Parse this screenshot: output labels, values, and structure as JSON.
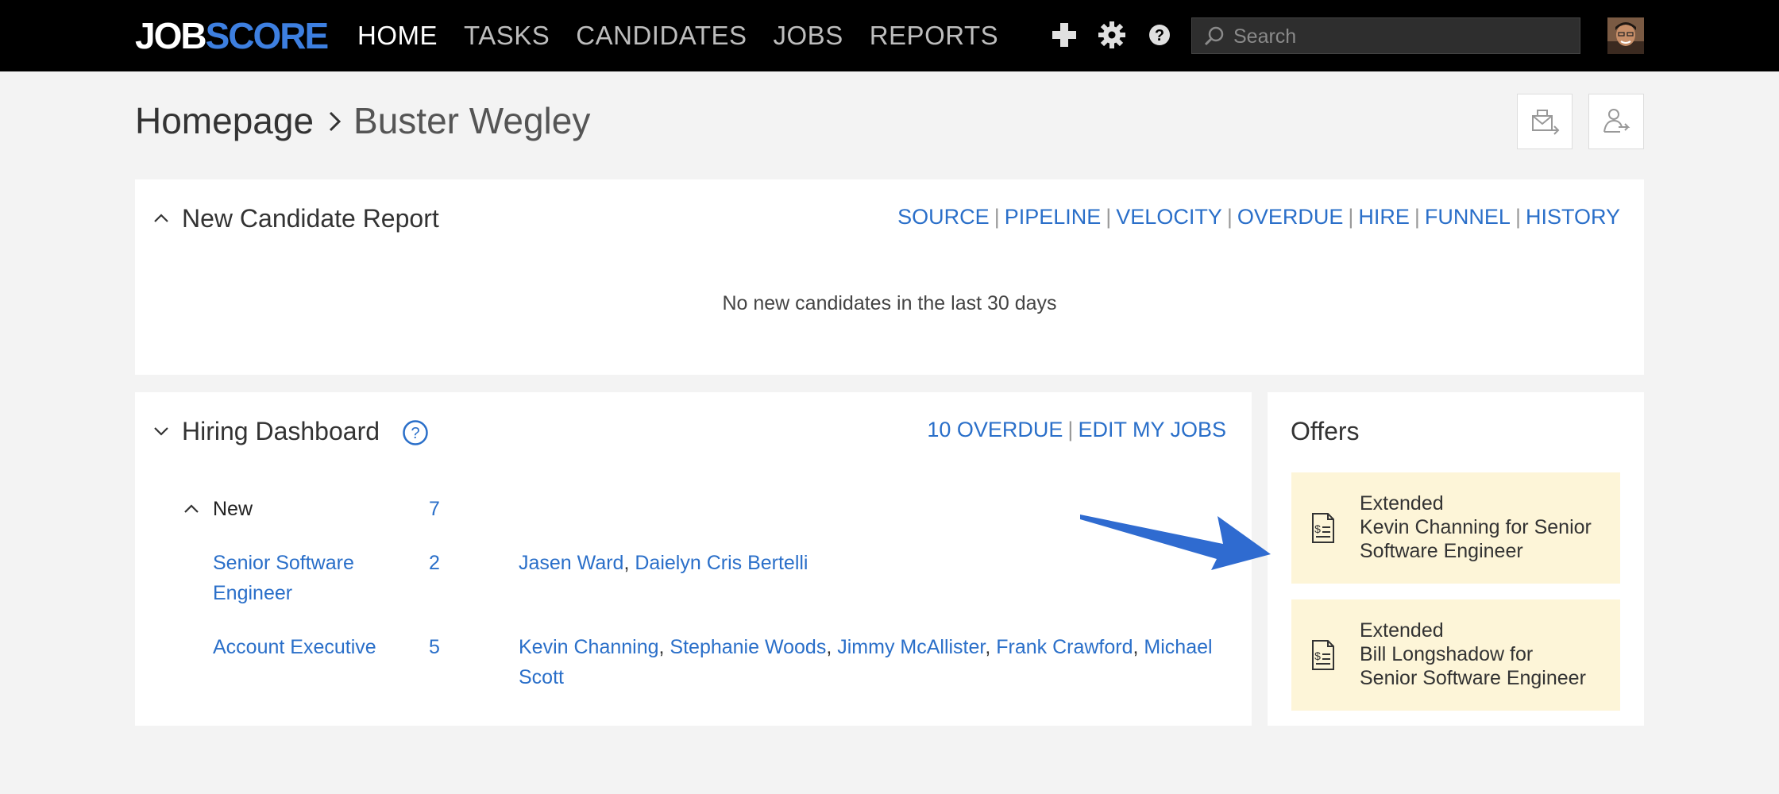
{
  "app": {
    "logo_part1": "JOB",
    "logo_part2": "SCORE",
    "accent": "#3d7fe0"
  },
  "nav": {
    "items": [
      {
        "label": "HOME",
        "active": true
      },
      {
        "label": "TASKS",
        "active": false
      },
      {
        "label": "CANDIDATES",
        "active": false
      },
      {
        "label": "JOBS",
        "active": false
      },
      {
        "label": "REPORTS",
        "active": false
      }
    ]
  },
  "toolbar": {
    "icons": [
      "plus-icon",
      "gear-icon",
      "help-icon"
    ],
    "search_placeholder": "Search"
  },
  "header": {
    "crumb_root": "Homepage",
    "crumb_current": "Buster Wegley",
    "buttons": [
      "email-forward-icon",
      "user-forward-icon"
    ]
  },
  "new_candidate_report": {
    "title": "New Candidate Report",
    "links": [
      "SOURCE",
      "PIPELINE",
      "VELOCITY",
      "OVERDUE",
      "HIRE",
      "FUNNEL",
      "HISTORY"
    ],
    "empty_message": "No new candidates in the last 30 days"
  },
  "hiring_dashboard": {
    "title": "Hiring Dashboard",
    "overdue_link": "10 OVERDUE",
    "edit_link": "EDIT MY JOBS",
    "group": {
      "label": "New",
      "count": "7"
    },
    "jobs": [
      {
        "name_line1": "Senior Software",
        "name_line2": "Engineer",
        "count": "2",
        "candidates": [
          "Jasen Ward",
          "Daielyn Cris Bertelli"
        ]
      },
      {
        "name_line1": "Account Executive",
        "name_line2": "",
        "count": "5",
        "candidates": [
          "Kevin Channing",
          "Stephanie Woods",
          "Jimmy McAllister",
          "Frank Crawford",
          "Michael",
          "Scott"
        ]
      }
    ]
  },
  "offers": {
    "title": "Offers",
    "items": [
      {
        "status": "Extended",
        "line2": "Kevin Channing for Senior",
        "line3": "Software Engineer"
      },
      {
        "status": "Extended",
        "line2": "Bill Longshadow for",
        "line3": "Senior Software Engineer"
      }
    ],
    "highlight_bg": "#fdf5d8"
  }
}
